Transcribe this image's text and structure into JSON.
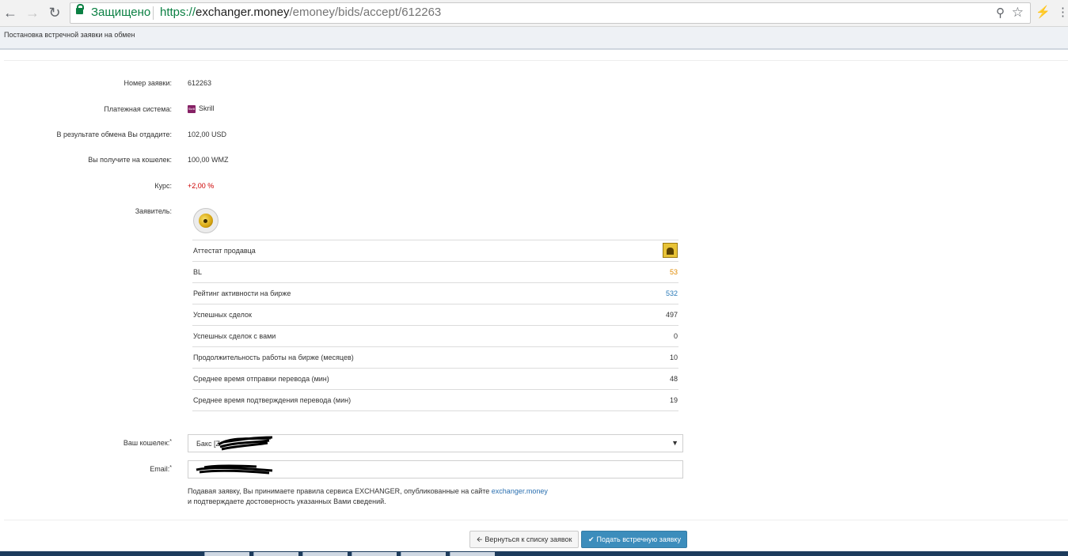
{
  "browser": {
    "secure_label": "Защищено",
    "url_scheme": "https://",
    "url_host": "exchanger.money",
    "url_path": "/emoney/bids/accept/612263"
  },
  "page": {
    "title": "Постановка встречной заявки на обмен"
  },
  "form": {
    "order_number_label": "Номер заявки:",
    "order_number": "612263",
    "payment_system_label": "Платежная система:",
    "payment_system_logo": "Skrill",
    "payment_system": "Skrill",
    "give_label": "В результате обмена Вы отдадите:",
    "give_amount": "102,00 USD",
    "receive_label": "Вы получите на кошелек:",
    "receive_amount": "100,00 WMZ",
    "rate_label": "Курс:",
    "rate": "+2,00 %",
    "applicant_label": "Заявитель:"
  },
  "stats": [
    {
      "name": "Аттестат продавца",
      "value": null,
      "badge": "attestat-icon"
    },
    {
      "name": "BL",
      "value": "53",
      "color": "#e08a00"
    },
    {
      "name": "Рейтинг активности на бирже",
      "value": "532",
      "color": "#2a7ab8"
    },
    {
      "name": "Успешных сделок",
      "value": "497"
    },
    {
      "name": "Успешных сделок с вами",
      "value": "0"
    },
    {
      "name": "Продолжительность работы на бирже (месяцев)",
      "value": "10"
    },
    {
      "name": "Среднее время отправки перевода (мин)",
      "value": "48"
    },
    {
      "name": "Среднее время подтверждения перевода (мин)",
      "value": "19"
    }
  ],
  "wallet": {
    "label": "Ваш кошелек:",
    "required_mark": "*",
    "selected": "Бакс [Z"
  },
  "email": {
    "label": "Email:",
    "required_mark": "*"
  },
  "note": {
    "line1_prefix": "Подавая заявку, Вы принимаете правила сервиса EXCHANGER, опубликованные на сайте ",
    "link": "exchanger.money",
    "line2": "и подтверждаете достоверность указанных Вами сведений."
  },
  "buttons": {
    "back": "Вернуться к списку заявок",
    "submit": "Подать встречную заявку"
  },
  "colors": {
    "accent": "#3c8dbc",
    "secure": "#0b8043",
    "rate": "#cc0000"
  }
}
